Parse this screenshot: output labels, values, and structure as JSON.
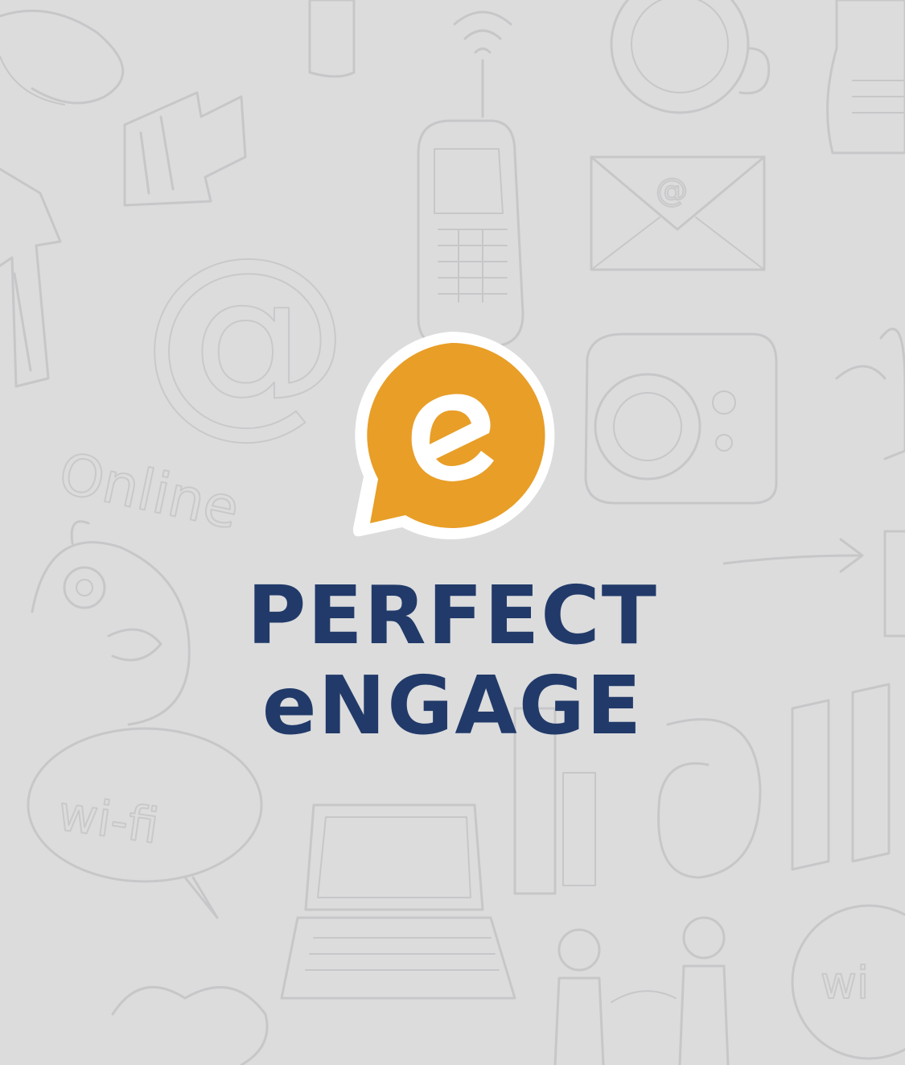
{
  "brand": {
    "line1": "PERFECT",
    "line2": "eNGAGE",
    "logo_letter": "e",
    "colors": {
      "background": "#dcdcdd",
      "accent": "#e89e27",
      "text": "#213a69",
      "logo_outline": "#ffffff"
    }
  },
  "background_doodles": {
    "texts": [
      "Online",
      "wi-fi",
      "wi",
      "@"
    ],
    "icons": [
      "arrow-icon",
      "wifi-antenna-icon",
      "cellphone-icon",
      "envelope-icon",
      "camera-icon",
      "at-sign-icon",
      "bird-icon",
      "speech-bubble-icon",
      "laptop-icon",
      "people-icon",
      "heart-icon",
      "coffee-cup-icon"
    ]
  }
}
